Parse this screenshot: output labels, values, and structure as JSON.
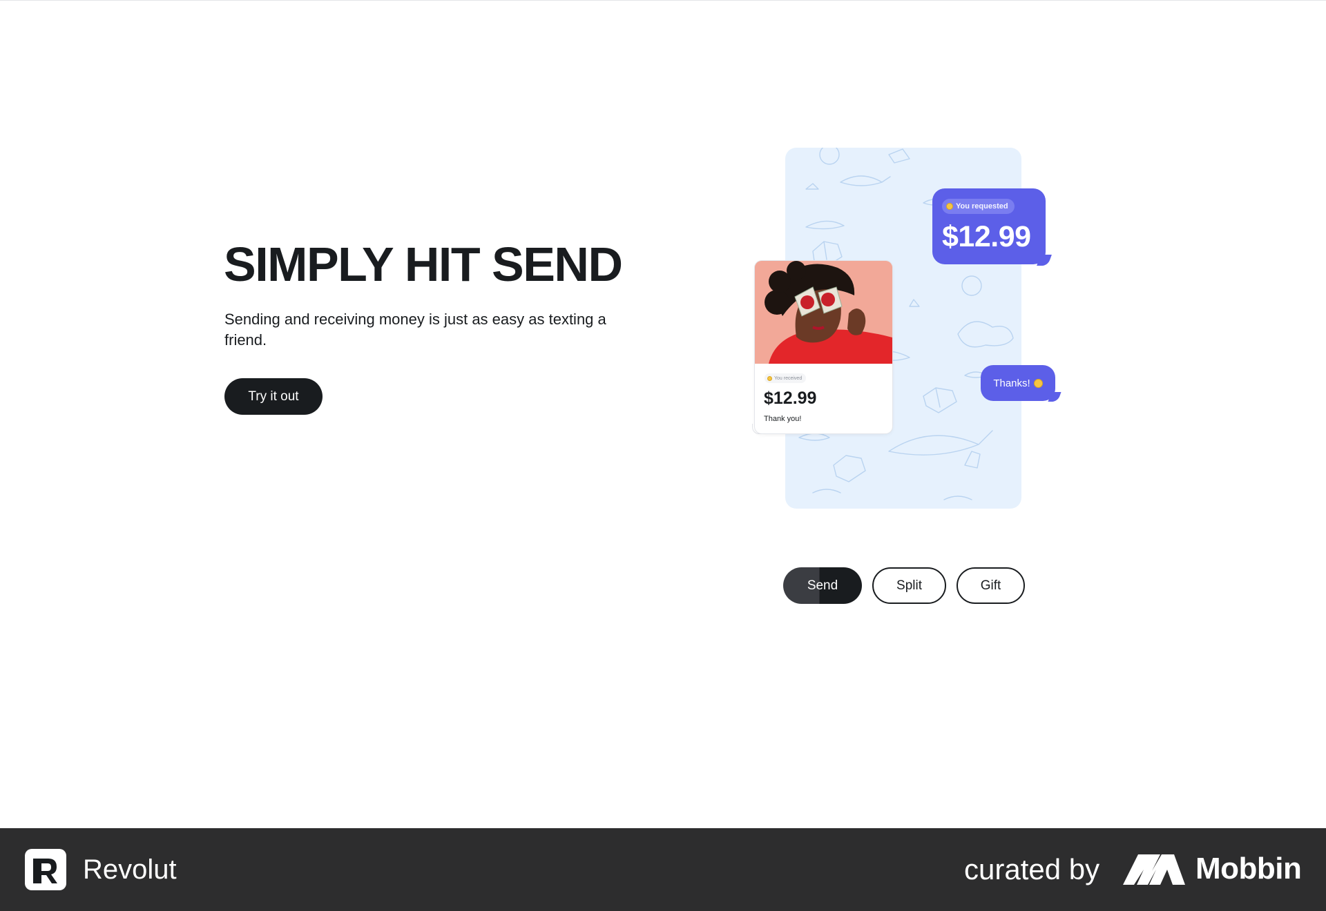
{
  "hero": {
    "title": "SIMPLY HIT SEND",
    "subtitle": "Sending and receiving money is just as easy as texting a friend.",
    "cta_label": "Try it out"
  },
  "illustration": {
    "request_bubble": {
      "chip": "You requested",
      "amount": "$12.99"
    },
    "received_card": {
      "tag": "You received",
      "amount": "$12.99",
      "note": "Thank you!"
    },
    "thanks_bubble": {
      "text": "Thanks!"
    },
    "colors": {
      "bubble": "#5c5fe8",
      "phone_bg": "#e6f1fd",
      "photo_bg": "#f2a898"
    }
  },
  "tabs": [
    {
      "label": "Send",
      "active": true
    },
    {
      "label": "Split",
      "active": false
    },
    {
      "label": "Gift",
      "active": false
    }
  ],
  "footer": {
    "brand": "Revolut",
    "curated_by": "curated by",
    "curator": "Mobbin",
    "background": "#2d2d2e"
  }
}
